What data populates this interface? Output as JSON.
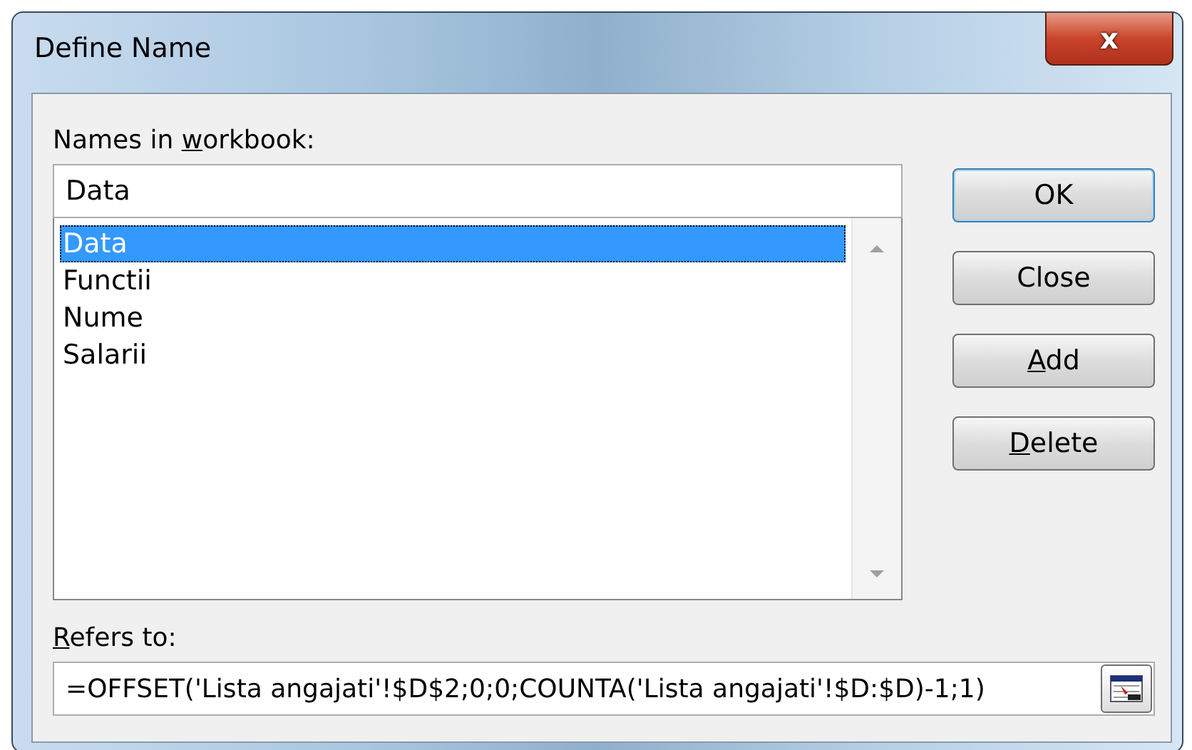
{
  "window": {
    "title": "Define Name",
    "close": "x"
  },
  "names_label": {
    "before": "Names in ",
    "access_key": "w",
    "after": "orkbook:"
  },
  "name_field": {
    "value": "Data"
  },
  "names_list": [
    {
      "label": "Data",
      "selected": true
    },
    {
      "label": "Functii",
      "selected": false
    },
    {
      "label": "Nume",
      "selected": false
    },
    {
      "label": "Salarii",
      "selected": false
    }
  ],
  "buttons": [
    {
      "before": "OK",
      "default": true
    },
    {
      "before": "Close",
      "default": false
    },
    {
      "access_key": "A",
      "after": "dd",
      "default": false
    },
    {
      "access_key": "D",
      "after": "elete",
      "default": false
    }
  ],
  "refers_label": {
    "access_key": "R",
    "after": "efers to:"
  },
  "refers_field": {
    "value": "=OFFSET('Lista angajati'!$D$2;0;0;COUNTA('Lista angajati'!$D:$D)-1;1)"
  }
}
